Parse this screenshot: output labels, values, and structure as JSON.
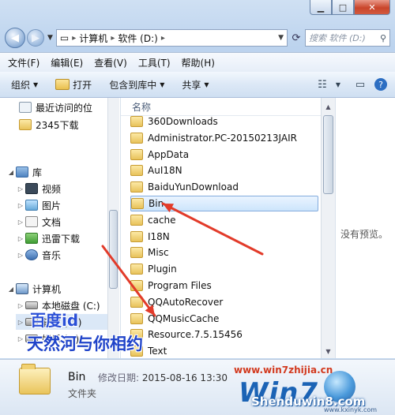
{
  "window": {
    "minimize_glyph": "▁",
    "maximize_glyph": "□",
    "close_glyph": "✕"
  },
  "nav": {
    "back_glyph": "◀",
    "forward_glyph": "▶",
    "address": [
      "计算机",
      "软件 (D:)"
    ],
    "crumb_sep": "▸",
    "search_placeholder": "搜索 软件 (D:)"
  },
  "menu": [
    "文件(F)",
    "编辑(E)",
    "查看(V)",
    "工具(T)",
    "帮助(H)"
  ],
  "toolbar": {
    "organize": "组织",
    "open": "打开",
    "include_library": "包含到库中",
    "share": "共享"
  },
  "sidebar": {
    "items": [
      {
        "label": "最近访问的位",
        "icon": "recent-icon"
      },
      {
        "label": "2345下载",
        "icon": "folder-icon"
      },
      {
        "label": "库",
        "icon": "library-icon"
      },
      {
        "label": "视频",
        "icon": "video-icon"
      },
      {
        "label": "图片",
        "icon": "pictures-icon"
      },
      {
        "label": "文档",
        "icon": "documents-icon"
      },
      {
        "label": "迅雷下载",
        "icon": "download-icon"
      },
      {
        "label": "音乐",
        "icon": "music-icon"
      },
      {
        "label": "计算机",
        "icon": "computer-icon"
      },
      {
        "label": "本地磁盘 (C:)",
        "icon": "disk-icon"
      },
      {
        "label": "软件 (D:)",
        "icon": "disk-icon"
      },
      {
        "label": "娱乐 (F:)",
        "icon": "disk-icon"
      }
    ]
  },
  "list": {
    "column_name": "名称",
    "files": [
      "360Downloads",
      "Administrator.PC-20150213JAIR",
      "AppData",
      "AuI18N",
      "BaiduYunDownload",
      "Bin",
      "cache",
      "I18N",
      "Misc",
      "Plugin",
      "Program Files",
      "QQAutoRecover",
      "QQMusicCache",
      "Resource.7.5.15456",
      "Text"
    ],
    "selected": "Bin"
  },
  "preview": {
    "no_preview": "没有预览。"
  },
  "details": {
    "name": "Bin",
    "modified_label": "修改日期:",
    "modified_value": "2015-08-16 13:30",
    "type": "文件夹"
  },
  "overlay": {
    "line1": "百度id",
    "line2": "天然河与你相约"
  },
  "watermark": {
    "site": "www.win7zhijia.cn",
    "logo": "Win7",
    "brand": "Shenduwin8.com",
    "small": "www.kxinyk.com"
  },
  "colors": {
    "arrow": "#e23b2a",
    "selection": "#cde5fc",
    "overlay_text": "#2a4fd6"
  }
}
